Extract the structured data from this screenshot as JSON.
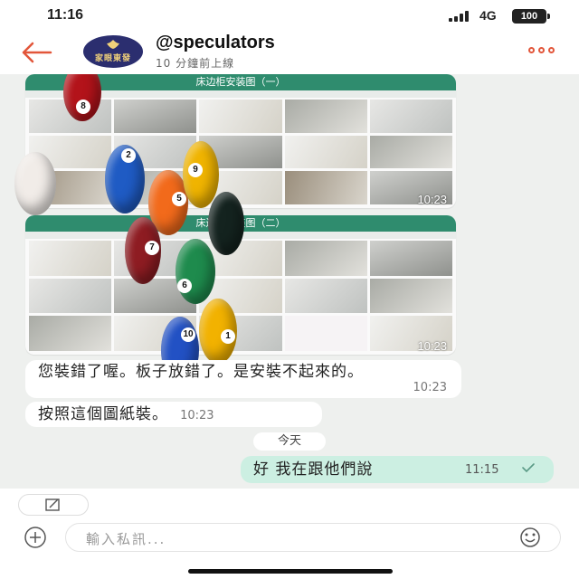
{
  "status_bar": {
    "time": "11:16",
    "network": "4G",
    "battery": "100"
  },
  "header": {
    "contact_name": "@speculators",
    "last_seen": "10 分鐘前上線",
    "avatar_text": "家眼東發"
  },
  "messages": [
    {
      "type": "image",
      "title": "床边柜安装图（一）",
      "time": "10:23"
    },
    {
      "type": "image",
      "title": "床边柜安装图（二）",
      "time": "10:23"
    },
    {
      "type": "text",
      "direction": "in",
      "text": "您裝錯了喔。板子放錯了。是安裝不起來的。",
      "time": "10:23"
    },
    {
      "type": "text",
      "direction": "in",
      "text": "按照這個圖紙裝。",
      "time": "10:23"
    },
    {
      "type": "date",
      "text": "今天"
    },
    {
      "type": "text",
      "direction": "out",
      "text": "好 我在跟他們說",
      "time": "11:15"
    }
  ],
  "composer": {
    "placeholder": "輸入私訊..."
  },
  "colors": {
    "accent": "#e2563a",
    "outgoing_bubble": "#ccefe2",
    "image_title_bar": "#2f8c6e"
  }
}
